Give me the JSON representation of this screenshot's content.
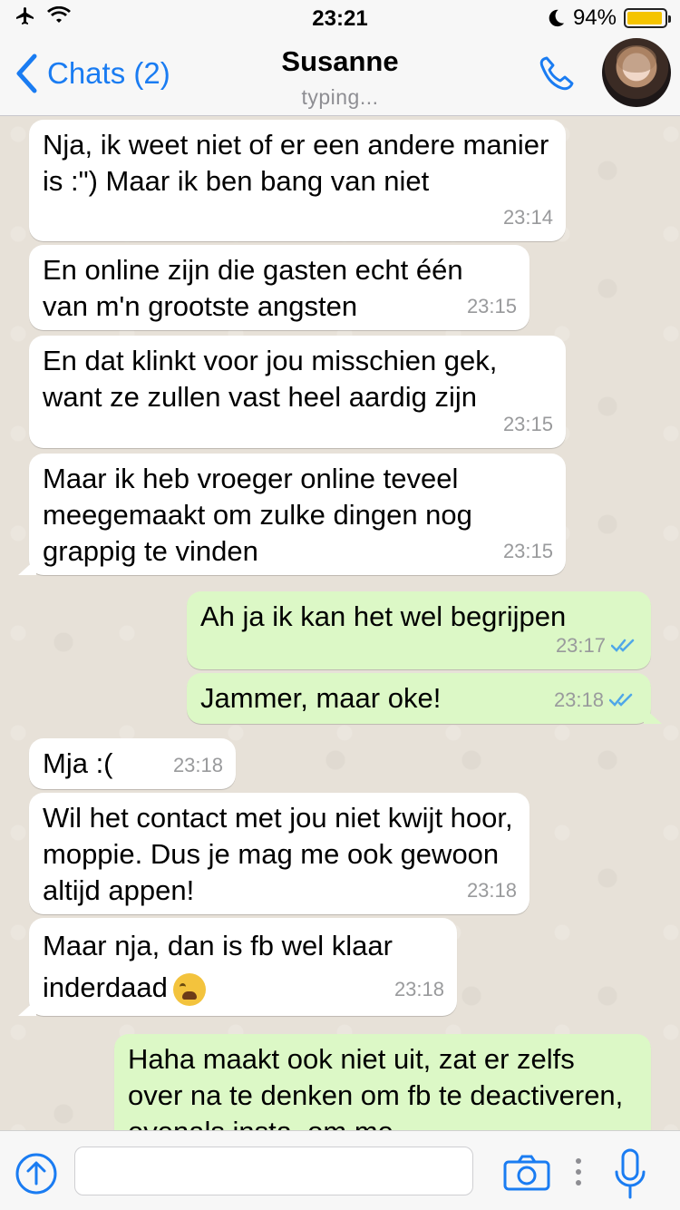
{
  "status": {
    "time": "23:21",
    "battery": "94%",
    "battery_level": 0.94
  },
  "header": {
    "back_label": "Chats (2)",
    "contact_name": "Susanne",
    "subtitle": "typing..."
  },
  "messages": [
    {
      "dir": "in",
      "text": "Nja, ik weet niet of er een andere manier is :\") Maar ik ben bang van niet",
      "time": "23:14"
    },
    {
      "dir": "in",
      "text": "En online zijn die gasten echt één van m'n grootste angsten",
      "time": "23:15"
    },
    {
      "dir": "in",
      "text": "En dat klinkt voor jou misschien gek, want ze zullen vast heel aardig zijn",
      "time": "23:15"
    },
    {
      "dir": "in",
      "text": "Maar ik heb vroeger online teveel meegemaakt om zulke dingen nog grappig te vinden",
      "time": "23:15"
    },
    {
      "dir": "out",
      "text": "Ah ja ik kan het wel begrijpen",
      "time": "23:17"
    },
    {
      "dir": "out",
      "text": "Jammer, maar oke!",
      "time": "23:18"
    },
    {
      "dir": "in",
      "text": "Mja :(",
      "time": "23:18"
    },
    {
      "dir": "in",
      "text": "Wil het contact met jou niet kwijt hoor, moppie. Dus je mag me ook gewoon altijd appen!",
      "time": "23:18"
    },
    {
      "dir": "in",
      "text": "Maar nja, dan is fb wel klaar inderdaad",
      "time": "23:18"
    },
    {
      "dir": "out",
      "text": "Haha maakt ook niet uit, zat er zelfs over na te denken om fb te deactiveren, evenals insta, om me",
      "time": ""
    }
  ],
  "composer": {
    "value": "",
    "placeholder": ""
  },
  "colors": {
    "accent": "#1a7cf2",
    "incoming_bubble": "#ffffff",
    "outgoing_bubble": "#dcf8c6",
    "read_ticks": "#4fa7e8"
  },
  "icons": {
    "airplane": "airplane-icon",
    "wifi": "wifi-icon",
    "moon": "moon-icon",
    "call": "phone-icon",
    "send_up": "upload-arrow-icon",
    "camera": "camera-icon",
    "more": "more-vertical-icon",
    "mic": "microphone-icon"
  }
}
